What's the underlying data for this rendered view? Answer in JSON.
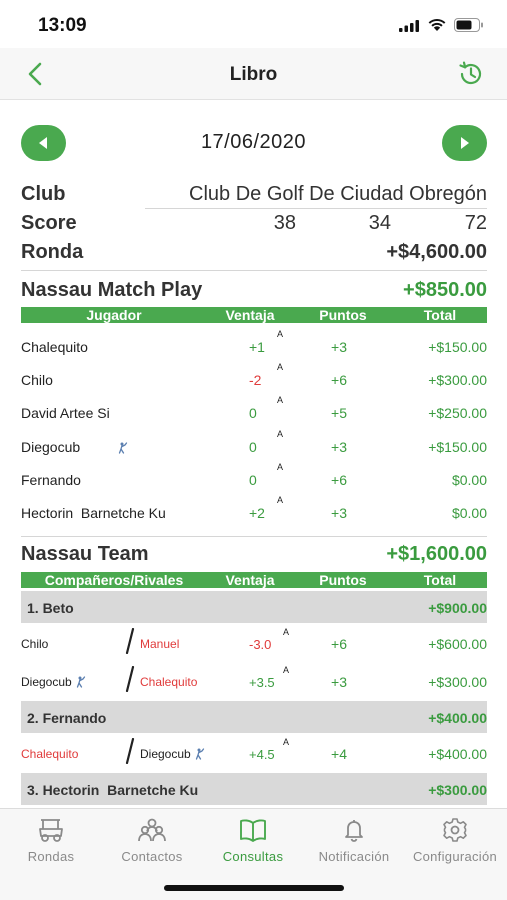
{
  "status_bar": {
    "time": "13:09"
  },
  "nav": {
    "title": "Libro",
    "back_icon": "chevron-left-icon",
    "history_icon": "history-icon"
  },
  "date": "17/06/2020",
  "summary": {
    "club_label": "Club",
    "club_value": "Club De Golf De Ciudad Obregón",
    "score_label": "Score",
    "score_values": [
      "38",
      "34",
      "72"
    ],
    "ronda_label": "Ronda",
    "ronda_value": "+$4,600.00"
  },
  "nassau_match": {
    "title": "Nassau Match Play",
    "total": "+$850.00",
    "headers": [
      "Jugador",
      "Ventaja",
      "Puntos",
      "Total"
    ],
    "rows": [
      {
        "name": "Chalequito",
        "ventaja": "+1",
        "sup": "A",
        "puntos": "+3",
        "total": "+$150.00",
        "ventaja_color": "green"
      },
      {
        "name": "Chilo",
        "ventaja": "-2",
        "sup": "A",
        "puntos": "+6",
        "total": "+$300.00",
        "ventaja_color": "red"
      },
      {
        "name": "David Artee Si",
        "ventaja": "0",
        "sup": "A",
        "puntos": "+5",
        "total": "+$250.00",
        "ventaja_color": "green"
      },
      {
        "name": "Diegocub",
        "golf_icon": true,
        "ventaja": "0",
        "sup": "A",
        "puntos": "+3",
        "total": "+$150.00",
        "ventaja_color": "green"
      },
      {
        "name": "Fernando",
        "ventaja": "0",
        "sup": "A",
        "puntos": "+6",
        "total": "$0.00",
        "ventaja_color": "green"
      },
      {
        "name": "Hectorin  Barnetche Ku",
        "ventaja": "+2",
        "sup": "A",
        "puntos": "+3",
        "total": "$0.00",
        "ventaja_color": "green"
      }
    ]
  },
  "nassau_team": {
    "title": "Nassau Team",
    "total": "+$1,600.00",
    "headers": [
      "Compañeros/Rivales",
      "Ventaja",
      "Puntos",
      "Total"
    ],
    "groups": [
      {
        "name": "1. Beto",
        "total": "+$900.00",
        "rows": [
          {
            "p1": "Chilo",
            "p1_color": "dark",
            "p2": "Manuel",
            "p2_color": "red",
            "ventaja": "-3.0",
            "sup": "A",
            "puntos": "+6",
            "total": "+$600.00",
            "ventaja_color": "red"
          },
          {
            "p1": "Diegocub",
            "p1_golf": true,
            "p1_color": "dark",
            "p2": "Chalequito",
            "p2_color": "red",
            "ventaja": "+3.5",
            "sup": "A",
            "puntos": "+3",
            "total": "+$300.00",
            "ventaja_color": "green"
          }
        ]
      },
      {
        "name": "2. Fernando",
        "total": "+$400.00",
        "rows": [
          {
            "p1": "Chalequito",
            "p1_color": "red",
            "p2": "Diegocub",
            "p2_golf": true,
            "p2_color": "dark",
            "ventaja": "+4.5",
            "sup": "A",
            "puntos": "+4",
            "total": "+$400.00",
            "ventaja_color": "green"
          }
        ]
      },
      {
        "name": "3. Hectorin  Barnetche Ku",
        "total": "+$300.00",
        "rows": []
      }
    ]
  },
  "tabs": [
    {
      "label": "Rondas",
      "icon": "golf-cart-icon",
      "active": false
    },
    {
      "label": "Contactos",
      "icon": "contacts-icon",
      "active": false
    },
    {
      "label": "Consultas",
      "icon": "book-icon",
      "active": true
    },
    {
      "label": "Notificación",
      "icon": "bell-icon",
      "active": false
    },
    {
      "label": "Configuración",
      "icon": "gear-icon",
      "active": false
    }
  ],
  "colors": {
    "accent": "#4aa94f",
    "positive": "#3a9b3f",
    "negative": "#e03b3b",
    "group_bg": "#d9d9d9"
  }
}
